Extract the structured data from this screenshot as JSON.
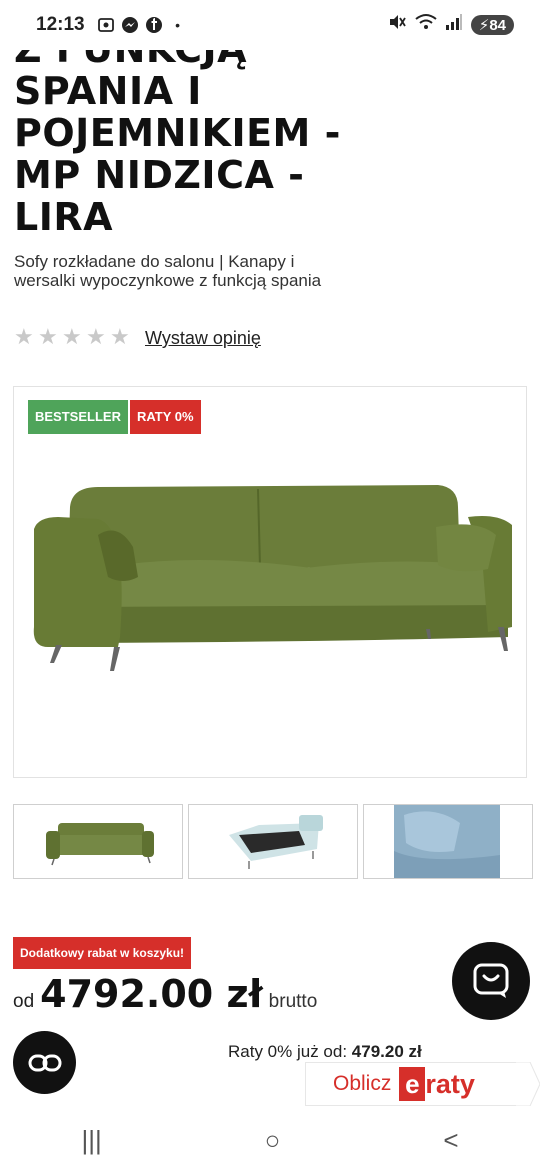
{
  "status_bar": {
    "time": "12:13",
    "icons": [
      "screenshot-icon",
      "messenger-icon",
      "facebook-icon",
      "dot-icon"
    ],
    "battery": "84"
  },
  "product": {
    "title": "Z FUNKCJĄ SPANIA I POJEMNIKIEM - MP NIDZICA - LIRA",
    "category": "Sofy rozkładane do salonu | Kanapy i wersalki wypoczynkowe z funkcją spania",
    "rating": 0,
    "review_link": "Wystaw opinię",
    "badges": [
      "BESTSELLER",
      "RATY 0%"
    ],
    "sofa_color": "#6b7d3a"
  },
  "pricing": {
    "promo": "Dodatkowy rabat w koszyku!",
    "prefix": "od",
    "price": "4792.00 zł",
    "suffix": "brutto",
    "installment_label": "Raty 0% już od:",
    "installment_value": "479.20 zł",
    "eraty_label": "Oblicz",
    "eraty_e": "e",
    "eraty_raty": "raty"
  },
  "nav": {
    "recent": "|||",
    "home": "○",
    "back": "<"
  }
}
